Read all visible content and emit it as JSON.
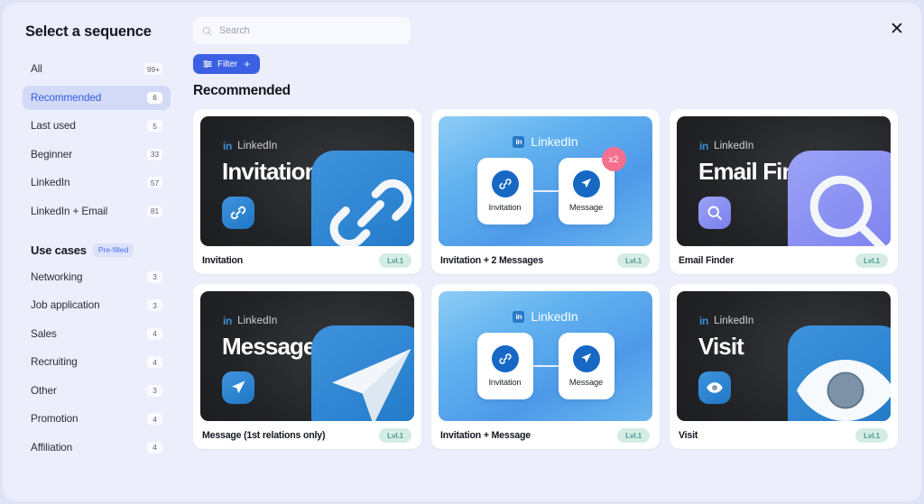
{
  "modal": {
    "title": "Select a sequence",
    "close_label": "✕"
  },
  "sidebar": {
    "items": [
      {
        "label": "All",
        "count": "99+"
      },
      {
        "label": "Recommended",
        "count": "6"
      },
      {
        "label": "Last used",
        "count": "5"
      },
      {
        "label": "Beginner",
        "count": "33"
      },
      {
        "label": "LinkedIn",
        "count": "57"
      },
      {
        "label": "LinkedIn + Email",
        "count": "81"
      }
    ],
    "usecases": {
      "title": "Use cases",
      "badge": "Pre-filled",
      "items": [
        {
          "label": "Networking",
          "count": "3"
        },
        {
          "label": "Job application",
          "count": "3"
        },
        {
          "label": "Sales",
          "count": "4"
        },
        {
          "label": "Recruiting",
          "count": "4"
        },
        {
          "label": "Other",
          "count": "3"
        },
        {
          "label": "Promotion",
          "count": "4"
        },
        {
          "label": "Affiliation",
          "count": "4"
        }
      ]
    }
  },
  "main": {
    "search": {
      "value": "",
      "placeholder": "Search"
    },
    "filter_button": {
      "label": "Filter",
      "plus": "+"
    },
    "section_title": "Recommended",
    "cards": [
      {
        "name": "Invitation",
        "level": "Lvl.1",
        "style": "dark",
        "network": "LinkedIn",
        "headline": "Invitation",
        "icon": "link-icon",
        "tile_color": "#2b82cd"
      },
      {
        "name": "Invitation + 2 Messages",
        "level": "Lvl.1",
        "style": "blue",
        "network": "LinkedIn",
        "nodes": [
          {
            "label": "Invitation",
            "icon": "link-icon"
          },
          {
            "label": "Message",
            "icon": "send-icon"
          }
        ],
        "multiplier": "x2"
      },
      {
        "name": "Email Finder",
        "level": "Lvl.1",
        "style": "dark",
        "network": "LinkedIn",
        "headline": "Email Finder",
        "icon": "search-icon",
        "tile_color": "#878cf2"
      },
      {
        "name": "Message (1st relations only)",
        "level": "Lvl.1",
        "style": "dark",
        "network": "LinkedIn",
        "headline": "Message",
        "icon": "send-icon",
        "tile_color": "#2b82cd"
      },
      {
        "name": "Invitation + Message",
        "level": "Lvl.1",
        "style": "blue",
        "network": "LinkedIn",
        "nodes": [
          {
            "label": "Invitation",
            "icon": "link-icon"
          },
          {
            "label": "Message",
            "icon": "send-icon"
          }
        ],
        "multiplier": ""
      },
      {
        "name": "Visit",
        "level": "Lvl.1",
        "style": "dark",
        "network": "LinkedIn",
        "headline": "Visit",
        "icon": "eye-icon",
        "tile_color": "#2b82cd"
      }
    ]
  },
  "colors": {
    "accent": "#3b60e4",
    "active_nav_bg": "#d3daf8",
    "active_nav_text": "#2f5de0",
    "level_badge_bg": "#d5ece5",
    "level_badge_text": "#4d9e90",
    "multiplier_badge": "#f4708e",
    "modal_bg": "#eceefb"
  }
}
